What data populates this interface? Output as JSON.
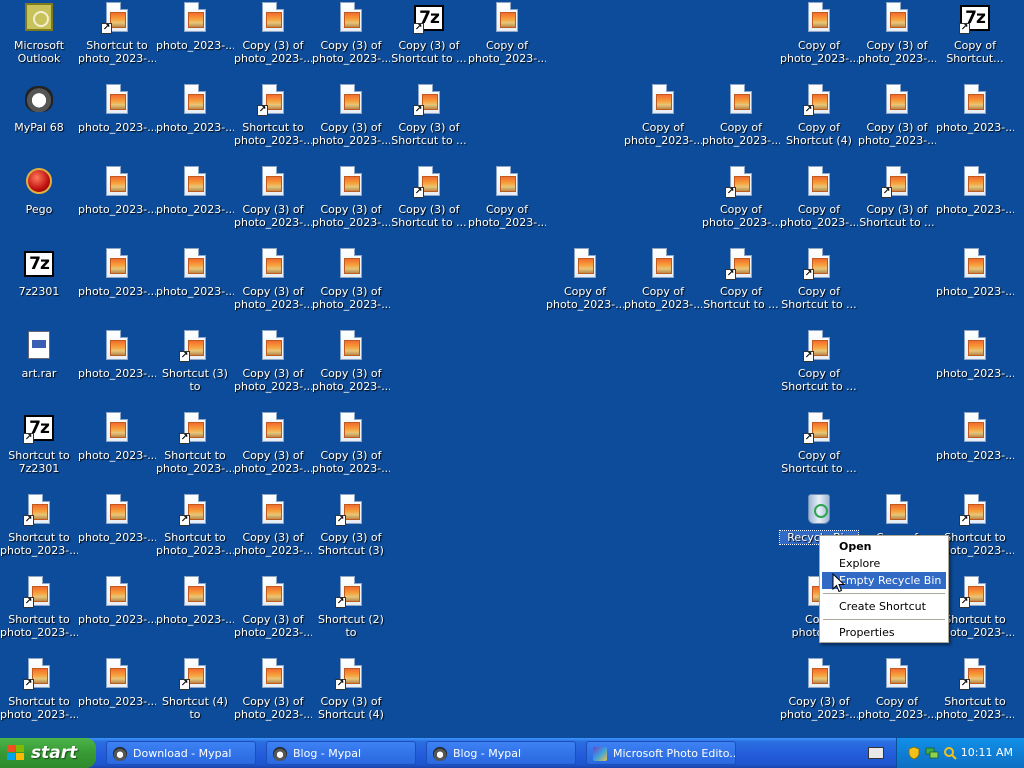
{
  "desktop": {
    "background_color": "#0d4c9a",
    "icons": [
      {
        "label": "Microsoft\nOutlook",
        "kind": "outlook",
        "col": 0,
        "row": 0
      },
      {
        "label": "Shortcut to\nphoto_2023-...",
        "kind": "photo",
        "shortcut": true,
        "col": 1,
        "row": 0
      },
      {
        "label": "photo_2023-...",
        "kind": "photo",
        "col": 2,
        "row": 0
      },
      {
        "label": "Copy (3) of\nphoto_2023-...",
        "kind": "photo",
        "col": 3,
        "row": 0
      },
      {
        "label": "Copy (3) of\nphoto_2023-...",
        "kind": "photo",
        "col": 4,
        "row": 0
      },
      {
        "label": "Copy (3) of\nShortcut to ...",
        "kind": "7z",
        "shortcut": true,
        "col": 5,
        "row": 0
      },
      {
        "label": "Copy of\nphoto_2023-...",
        "kind": "photo",
        "col": 6,
        "row": 0
      },
      {
        "label": "Copy of\nphoto_2023-...",
        "kind": "photo",
        "col": 10,
        "row": 0
      },
      {
        "label": "Copy (3) of\nphoto_2023-...",
        "kind": "photo",
        "col": 11,
        "row": 0
      },
      {
        "label": "Copy of\nShortcut...",
        "kind": "7z",
        "shortcut": true,
        "col": 12,
        "row": 0
      },
      {
        "label": "MyPal 68",
        "kind": "mypal",
        "col": 0,
        "row": 1
      },
      {
        "label": "photo_2023-...",
        "kind": "photo",
        "col": 1,
        "row": 1
      },
      {
        "label": "photo_2023-...",
        "kind": "photo",
        "col": 2,
        "row": 1
      },
      {
        "label": "Shortcut to\nphoto_2023-...",
        "kind": "photo",
        "shortcut": true,
        "col": 3,
        "row": 1
      },
      {
        "label": "Copy (3) of\nphoto_2023-...",
        "kind": "photo",
        "col": 4,
        "row": 1
      },
      {
        "label": "Copy (3) of\nShortcut to ...",
        "kind": "photo",
        "shortcut": true,
        "col": 5,
        "row": 1
      },
      {
        "label": "Copy of\nphoto_2023-...",
        "kind": "photo",
        "col": 8,
        "row": 1
      },
      {
        "label": "Copy of\nphoto_2023-...",
        "kind": "photo",
        "col": 9,
        "row": 1
      },
      {
        "label": "Copy of\nShortcut (4) ...",
        "kind": "photo",
        "shortcut": true,
        "col": 10,
        "row": 1
      },
      {
        "label": "Copy (3) of\nphoto_2023-...",
        "kind": "photo",
        "col": 11,
        "row": 1
      },
      {
        "label": "photo_2023-...",
        "kind": "photo",
        "col": 12,
        "row": 1
      },
      {
        "label": "Pego",
        "kind": "pego",
        "col": 0,
        "row": 2
      },
      {
        "label": "photo_2023-...",
        "kind": "photo",
        "col": 1,
        "row": 2
      },
      {
        "label": "photo_2023-...",
        "kind": "photo",
        "col": 2,
        "row": 2
      },
      {
        "label": "Copy (3) of\nphoto_2023-...",
        "kind": "photo",
        "col": 3,
        "row": 2
      },
      {
        "label": "Copy (3) of\nphoto_2023-...",
        "kind": "photo",
        "col": 4,
        "row": 2
      },
      {
        "label": "Copy (3) of\nShortcut to ...",
        "kind": "photo",
        "shortcut": true,
        "col": 5,
        "row": 2
      },
      {
        "label": "Copy of\nphoto_2023-...",
        "kind": "photo",
        "col": 6,
        "row": 2
      },
      {
        "label": "Copy of\nphoto_2023-...",
        "kind": "photo",
        "shortcut": true,
        "col": 9,
        "row": 2
      },
      {
        "label": "Copy of\nphoto_2023-...",
        "kind": "photo",
        "col": 10,
        "row": 2
      },
      {
        "label": "Copy (3) of\nShortcut to ...",
        "kind": "photo",
        "shortcut": true,
        "col": 11,
        "row": 2
      },
      {
        "label": "photo_2023-...",
        "kind": "photo",
        "col": 12,
        "row": 2
      },
      {
        "label": "7z2301",
        "kind": "7z",
        "col": 0,
        "row": 3
      },
      {
        "label": "photo_2023-...",
        "kind": "photo",
        "col": 1,
        "row": 3
      },
      {
        "label": "photo_2023-...",
        "kind": "photo",
        "col": 2,
        "row": 3
      },
      {
        "label": "Copy (3) of\nphoto_2023-...",
        "kind": "photo",
        "col": 3,
        "row": 3
      },
      {
        "label": "Copy (3) of\nphoto_2023-...",
        "kind": "photo",
        "col": 4,
        "row": 3
      },
      {
        "label": "Copy of\nphoto_2023-...",
        "kind": "photo",
        "col": 7,
        "row": 3
      },
      {
        "label": "Copy of\nphoto_2023-...",
        "kind": "photo",
        "col": 8,
        "row": 3
      },
      {
        "label": "Copy of\nShortcut to ...",
        "kind": "photo",
        "shortcut": true,
        "col": 9,
        "row": 3
      },
      {
        "label": "Copy of\nShortcut to ...",
        "kind": "photo",
        "shortcut": true,
        "col": 10,
        "row": 3
      },
      {
        "label": "photo_2023-...",
        "kind": "photo",
        "col": 12,
        "row": 3
      },
      {
        "label": "art.rar",
        "kind": "rar",
        "col": 0,
        "row": 4
      },
      {
        "label": "photo_2023-...",
        "kind": "photo",
        "col": 1,
        "row": 4
      },
      {
        "label": "Shortcut (3) to\nphoto_2023-...",
        "kind": "photo",
        "shortcut": true,
        "col": 2,
        "row": 4
      },
      {
        "label": "Copy (3) of\nphoto_2023-...",
        "kind": "photo",
        "col": 3,
        "row": 4
      },
      {
        "label": "Copy (3) of\nphoto_2023-...",
        "kind": "photo",
        "col": 4,
        "row": 4
      },
      {
        "label": "Copy of\nShortcut to ...",
        "kind": "photo",
        "shortcut": true,
        "col": 10,
        "row": 4
      },
      {
        "label": "photo_2023-...",
        "kind": "photo",
        "col": 12,
        "row": 4
      },
      {
        "label": "Shortcut to\n7z2301",
        "kind": "7z",
        "shortcut": true,
        "col": 0,
        "row": 5
      },
      {
        "label": "photo_2023-...",
        "kind": "photo",
        "col": 1,
        "row": 5
      },
      {
        "label": "Shortcut to\nphoto_2023-...",
        "kind": "photo",
        "shortcut": true,
        "col": 2,
        "row": 5
      },
      {
        "label": "Copy (3) of\nphoto_2023-...",
        "kind": "photo",
        "col": 3,
        "row": 5
      },
      {
        "label": "Copy (3) of\nphoto_2023-...",
        "kind": "photo",
        "col": 4,
        "row": 5
      },
      {
        "label": "Copy of\nShortcut to ...",
        "kind": "photo",
        "shortcut": true,
        "col": 10,
        "row": 5
      },
      {
        "label": "photo_2023-...",
        "kind": "photo",
        "col": 12,
        "row": 5
      },
      {
        "label": "Shortcut to\nphoto_2023-...",
        "kind": "photo",
        "shortcut": true,
        "col": 0,
        "row": 6
      },
      {
        "label": "photo_2023-...",
        "kind": "photo",
        "col": 1,
        "row": 6
      },
      {
        "label": "Shortcut to\nphoto_2023-...",
        "kind": "photo",
        "shortcut": true,
        "col": 2,
        "row": 6
      },
      {
        "label": "Copy (3) of\nphoto_2023-...",
        "kind": "photo",
        "col": 3,
        "row": 6
      },
      {
        "label": "Copy (3) of\nShortcut (3) ...",
        "kind": "photo",
        "shortcut": true,
        "col": 4,
        "row": 6
      },
      {
        "label": "Recycle Bin",
        "kind": "bin",
        "selected": true,
        "col": 10,
        "row": 6
      },
      {
        "label": "Copy of\nphoto_2023-...",
        "kind": "photo",
        "col": 11,
        "row": 6
      },
      {
        "label": "Shortcut to\nphoto_2023-...",
        "kind": "photo",
        "shortcut": true,
        "col": 12,
        "row": 6
      },
      {
        "label": "Shortcut to\nphoto_2023-...",
        "kind": "photo",
        "shortcut": true,
        "col": 0,
        "row": 7
      },
      {
        "label": "photo_2023-...",
        "kind": "photo",
        "col": 1,
        "row": 7
      },
      {
        "label": "photo_2023-...",
        "kind": "photo",
        "col": 2,
        "row": 7
      },
      {
        "label": "Copy (3) of\nphoto_2023-...",
        "kind": "photo",
        "col": 3,
        "row": 7
      },
      {
        "label": "Shortcut (2) to\nphoto_2023-...",
        "kind": "photo",
        "shortcut": true,
        "col": 4,
        "row": 7
      },
      {
        "label": "Copy\nphoto_2...",
        "kind": "photo",
        "col": 10,
        "row": 7
      },
      {
        "label": "Shortcut to\nphoto_2023-...",
        "kind": "photo",
        "shortcut": true,
        "col": 12,
        "row": 7
      },
      {
        "label": "Shortcut to\nphoto_2023-...",
        "kind": "photo",
        "shortcut": true,
        "col": 0,
        "row": 8
      },
      {
        "label": "photo_2023-...",
        "kind": "photo",
        "col": 1,
        "row": 8
      },
      {
        "label": "Shortcut (4) to\nphoto_2023-...",
        "kind": "photo",
        "shortcut": true,
        "col": 2,
        "row": 8
      },
      {
        "label": "Copy (3) of\nphoto_2023-...",
        "kind": "photo",
        "col": 3,
        "row": 8
      },
      {
        "label": "Copy (3) of\nShortcut (4) ...",
        "kind": "photo",
        "shortcut": true,
        "col": 4,
        "row": 8
      },
      {
        "label": "Copy (3) of\nphoto_2023-...",
        "kind": "photo",
        "col": 10,
        "row": 8
      },
      {
        "label": "Copy of\nphoto_2023-...",
        "kind": "photo",
        "col": 11,
        "row": 8
      },
      {
        "label": "Shortcut to\nphoto_2023-...",
        "kind": "photo",
        "shortcut": true,
        "col": 12,
        "row": 8
      }
    ]
  },
  "context_menu": {
    "items": [
      {
        "label": "Open",
        "bold": true
      },
      {
        "label": "Explore"
      },
      {
        "label": "Empty Recycle Bin",
        "highlighted": true
      },
      {
        "separator": true
      },
      {
        "label": "Create Shortcut"
      },
      {
        "separator": true
      },
      {
        "label": "Properties"
      }
    ],
    "highlight_color": "#316ac5"
  },
  "taskbar": {
    "start_label": "start",
    "tasks": [
      {
        "label": "Download - Mypal",
        "icon": "mypal-icon"
      },
      {
        "label": "Blog - Mypal",
        "icon": "mypal-icon"
      },
      {
        "label": "Blog - Mypal",
        "icon": "mypal-icon"
      },
      {
        "label": "Microsoft Photo Edito...",
        "icon": "photo-editor-icon"
      }
    ],
    "clock": "10:11 AM"
  }
}
